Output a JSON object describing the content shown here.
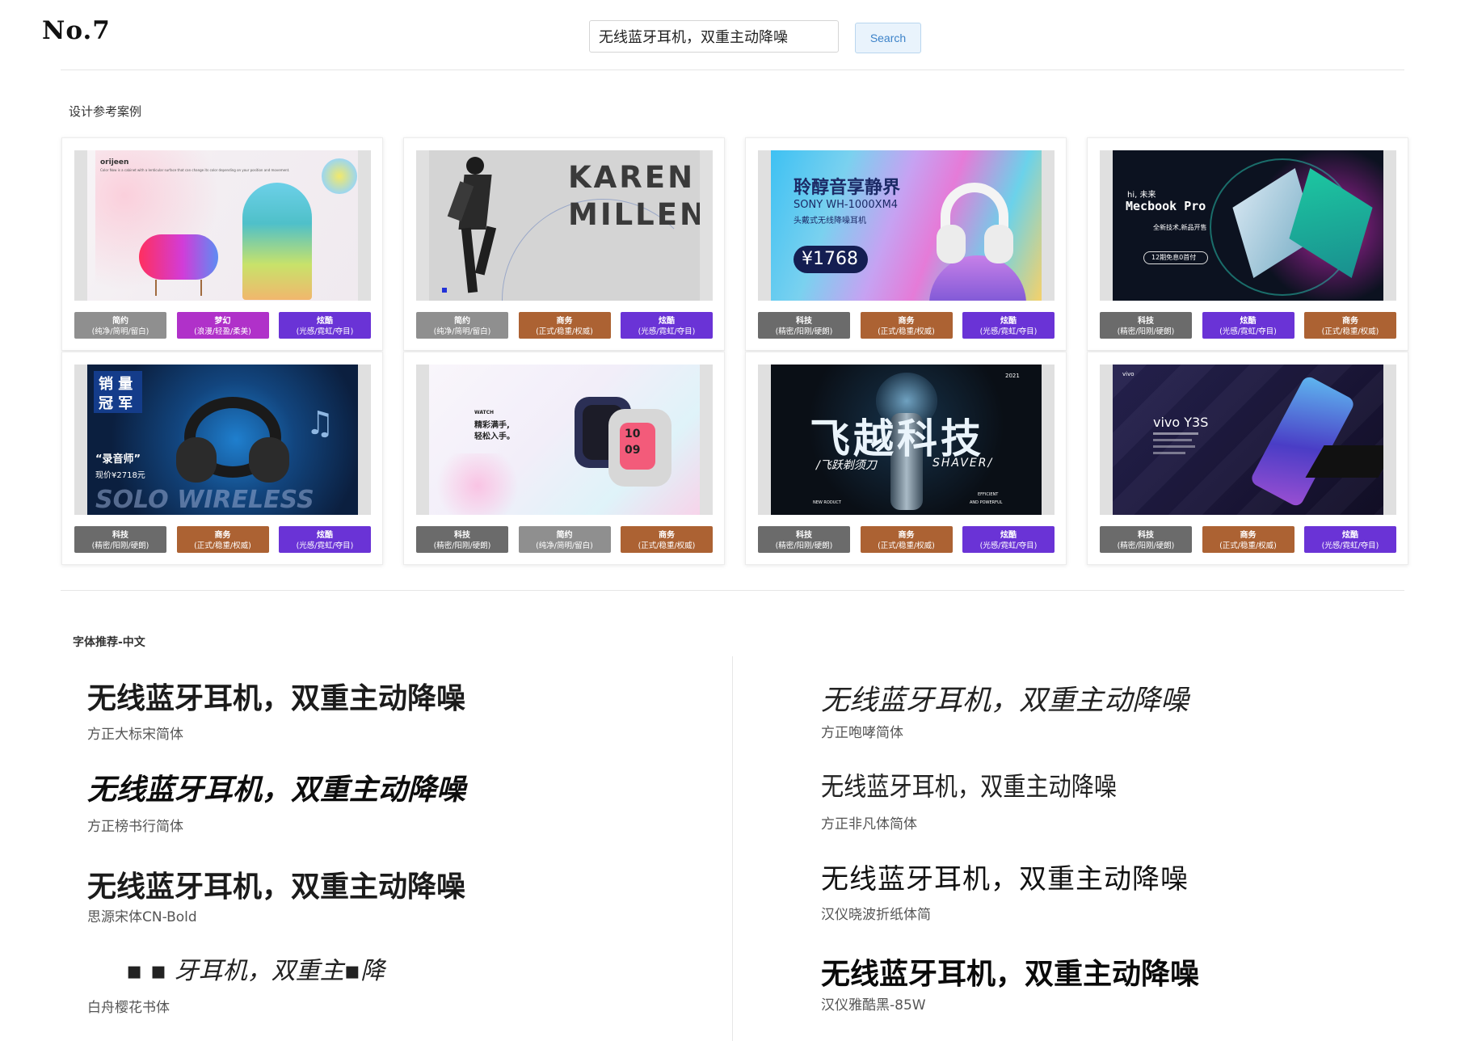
{
  "header": {
    "logo": "No.7",
    "search_value": "无线蓝牙耳机，双重主动降噪",
    "search_button": "Search"
  },
  "design_section": {
    "title": "设计参考案例",
    "cards": [
      {
        "thumb_text": [
          "orijeen",
          "Color Now is a cabinet with a lenticular surface that can change its color depending on your position and movement."
        ],
        "tags": [
          {
            "name": "简约",
            "desc": "(纯净/简明/留白)",
            "color": "#8f8f8f"
          },
          {
            "name": "梦幻",
            "desc": "(浪漫/轻盈/柔美)",
            "color": "#b031c9"
          },
          {
            "name": "炫酷",
            "desc": "(光感/霓虹/夺目)",
            "color": "#6a33d6"
          }
        ]
      },
      {
        "thumb_text": [
          "KAREN",
          "MILLEN"
        ],
        "tags": [
          {
            "name": "简约",
            "desc": "(纯净/简明/留白)",
            "color": "#8f8f8f"
          },
          {
            "name": "商务",
            "desc": "(正式/稳重/权威)",
            "color": "#ac6233"
          },
          {
            "name": "炫酷",
            "desc": "(光感/霓虹/夺目)",
            "color": "#6a33d6"
          }
        ]
      },
      {
        "thumb_text": [
          "聆醇音享静界",
          "SONY WH-1000XM4",
          "头戴式无线降噪耳机",
          "¥1768"
        ],
        "tags": [
          {
            "name": "科技",
            "desc": "(精密/阳刚/硬朗)",
            "color": "#6b6b6b"
          },
          {
            "name": "商务",
            "desc": "(正式/稳重/权威)",
            "color": "#ac6233"
          },
          {
            "name": "炫酷",
            "desc": "(光感/霓虹/夺目)",
            "color": "#6a33d6"
          }
        ]
      },
      {
        "thumb_text": [
          "hi, 未来",
          "Mecbook Pro",
          "全新技术,新品开售",
          "12期免息0首付"
        ],
        "tags": [
          {
            "name": "科技",
            "desc": "(精密/阳刚/硬朗)",
            "color": "#6b6b6b"
          },
          {
            "name": "炫酷",
            "desc": "(光感/霓虹/夺目)",
            "color": "#6a33d6"
          },
          {
            "name": "商务",
            "desc": "(正式/稳重/权威)",
            "color": "#ac6233"
          }
        ]
      },
      {
        "thumb_text": [
          "销 量",
          "冠 军",
          "“录音师”",
          "现价¥2718元",
          "SOLO WIRELESS"
        ],
        "tags": [
          {
            "name": "科技",
            "desc": "(精密/阳刚/硬朗)",
            "color": "#6b6b6b"
          },
          {
            "name": "商务",
            "desc": "(正式/稳重/权威)",
            "color": "#ac6233"
          },
          {
            "name": "炫酷",
            "desc": "(光感/霓虹/夺目)",
            "color": "#6a33d6"
          }
        ]
      },
      {
        "thumb_text": [
          "WATCH",
          "精彩满手,",
          "轻松入手。",
          "10",
          "09"
        ],
        "tags": [
          {
            "name": "科技",
            "desc": "(精密/阳刚/硬朗)",
            "color": "#6b6b6b"
          },
          {
            "name": "简约",
            "desc": "(纯净/简明/留白)",
            "color": "#8f8f8f"
          },
          {
            "name": "商务",
            "desc": "(正式/稳重/权威)",
            "color": "#ac6233"
          }
        ]
      },
      {
        "thumb_text": [
          "2021",
          "飞越科技",
          "/飞跃剃须刀",
          "SHAVER/",
          "NEW RODUCT",
          "EFFICIENT",
          "AND POWERFUL"
        ],
        "tags": [
          {
            "name": "科技",
            "desc": "(精密/阳刚/硬朗)",
            "color": "#6b6b6b"
          },
          {
            "name": "商务",
            "desc": "(正式/稳重/权威)",
            "color": "#ac6233"
          },
          {
            "name": "炫酷",
            "desc": "(光感/霓虹/夺目)",
            "color": "#6a33d6"
          }
        ]
      },
      {
        "thumb_text": [
          "vivo",
          "vivo Y3S"
        ],
        "tags": [
          {
            "name": "科技",
            "desc": "(精密/阳刚/硬朗)",
            "color": "#6b6b6b"
          },
          {
            "name": "商务",
            "desc": "(正式/稳重/权威)",
            "color": "#ac6233"
          },
          {
            "name": "炫酷",
            "desc": "(光感/霓虹/夺目)",
            "color": "#6a33d6"
          }
        ]
      }
    ]
  },
  "font_section": {
    "title": "字体推荐-中文",
    "samples": [
      {
        "text": "无线蓝牙耳机，双重主动降噪",
        "font_name": "方正大标宋简体"
      },
      {
        "text": "无线蓝牙耳机，双重主动降噪",
        "font_name": "方正榜书行简体"
      },
      {
        "text": "无线蓝牙耳机，双重主动降噪",
        "font_name": "思源宋体CN-Bold"
      },
      {
        "text": "▪ ▪ 牙耳机，双重主▪降",
        "font_name": "白舟樱花书体"
      },
      {
        "text": "无线蓝牙耳机，双重主动降噪",
        "font_name": "方正咆哮简体"
      },
      {
        "text": "无线蓝牙耳机，双重主动降噪",
        "font_name": "方正非凡体简体"
      },
      {
        "text": "无线蓝牙耳机，双重主动降噪",
        "font_name": "汉仪晓波折纸体简"
      },
      {
        "text": "无线蓝牙耳机，双重主动降噪",
        "font_name": "汉仪雅酷黑-85W"
      }
    ]
  },
  "colors": {
    "tag_simple": "#8f8f8f",
    "tag_dreamy": "#b031c9",
    "tag_cool": "#6a33d6",
    "tag_business": "#ac6233",
    "tag_tech": "#6b6b6b",
    "search_button_bg": "#e9f3fc"
  }
}
